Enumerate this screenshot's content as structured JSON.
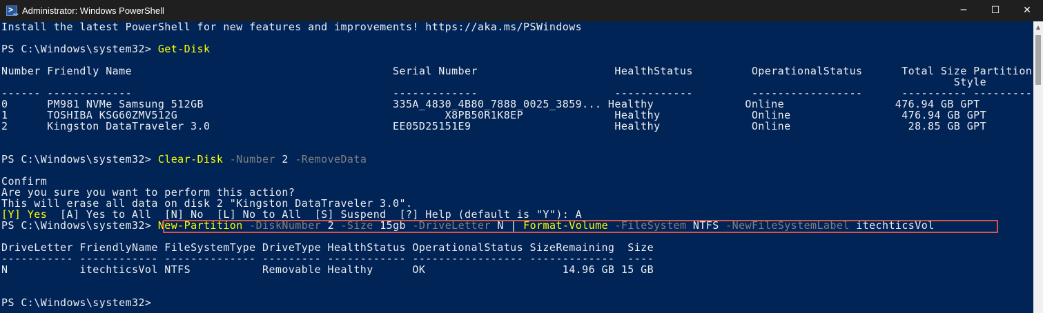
{
  "window": {
    "title": "Administrator: Windows PowerShell",
    "icon": "powershell-icon",
    "minimize_glyph": "─",
    "maximize_glyph": "☐",
    "close_glyph": "✕"
  },
  "colors": {
    "background": "#012456",
    "text": "#eeedf0",
    "command": "#ffff00",
    "parameter": "#808080",
    "highlight_box": "#d9534f"
  },
  "console": {
    "banner": "Install the latest PowerShell for new features and improvements! https://aka.ms/PSWindows",
    "prompt1": "PS C:\\Windows\\system32> ",
    "cmd1": "Get-Disk",
    "disk_header1": "Number Friendly Name                                        Serial Number                     HealthStatus         OperationalStatus      Total Size Partition",
    "disk_header2": "                                                                                                                                                  Style",
    "disk_sep": "------ -------------                                        -------------                     ------------         -----------------      ---------- ----------",
    "disk_rows": [
      "0      PM981 NVMe Samsung 512GB                             335A_4830_4B80_7888_0025_3859... Healthy              Online                 476.94 GB GPT",
      "1      TOSHIBA KSG60ZMV512G                                         X8PB50R1K8EP              Healthy              Online                 476.94 GB GPT",
      "2      Kingston DataTraveler 3.0                            EE05D25151E9                      Healthy              Online                  28.85 GB GPT"
    ],
    "prompt2": "PS C:\\Windows\\system32> ",
    "cmd2": {
      "name": "Clear-Disk",
      "p1": "-Number",
      "v1": "2",
      "p2": "-RemoveData"
    },
    "confirm_title": "Confirm",
    "confirm_q": "Are you sure you want to perform this action?",
    "confirm_detail": "This will erase all data on disk 2 \"Kingston DataTraveler 3.0\".",
    "choices": {
      "yes": "[Y] Yes",
      "rest": "  [A] Yes to All  [N] No  [L] No to All  [S] Suspend  [?] Help (default is \"Y\"): A"
    },
    "prompt3": "PS C:\\Windows\\system32> ",
    "cmd3": {
      "name1": "New-Partition",
      "p1": "-DiskNumber",
      "v1": "2",
      "p2": "-Size",
      "v2": "15gb",
      "p3": "-DriveLetter",
      "v3": "N",
      "pipe": "|",
      "name2": "Format-Volume",
      "p4": "-FileSystem",
      "v4": "NTFS",
      "p5": "-NewFileSystemLabel",
      "v5": "itechticsVol"
    },
    "vol_header": "DriveLetter FriendlyName FileSystemType DriveType HealthStatus OperationalStatus SizeRemaining  Size",
    "vol_sep": "----------- ------------ -------------- --------- ------------ ----------------- -------------  ----",
    "vol_row": "N           itechticsVol NTFS           Removable Healthy      OK                     14.96 GB 15 GB",
    "prompt4": "PS C:\\Windows\\system32>"
  }
}
